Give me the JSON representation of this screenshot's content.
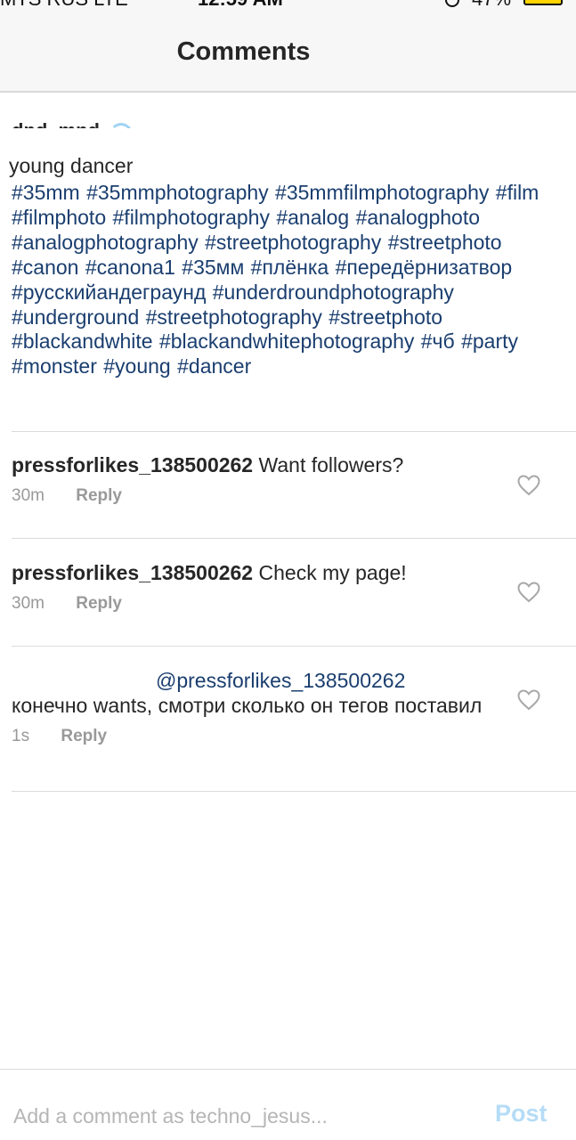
{
  "status_bar": {
    "carrier": "MTS RUS LTE",
    "time": "12:59 AM",
    "battery_pct": "47%"
  },
  "header": {
    "title": "Comments"
  },
  "caption": {
    "author": "dnd_mnd",
    "text": "young dancer",
    "hashtags": "#35mm #35mmphotography #35mmfilmphotography #film #filmphoto #filmphotography #analog #analogphoto #analogphotography #streetphotography #streetphoto #canon #canona1 #35мм #плёнка #передёрнизатвор #русскийандеграунд #underdroundphotography #underground #streetphotography #streetphoto #blackandwhite #blackandwhitephotography #чб #party #monster #young #dancer"
  },
  "comments": [
    {
      "username": "pressforlikes_138500262",
      "text": "Want followers?",
      "time": "30m",
      "reply_label": "Reply"
    },
    {
      "username": "pressforlikes_138500262",
      "text": "Check my page!",
      "time": "30m",
      "reply_label": "Reply"
    },
    {
      "username": "",
      "mention": "@pressforlikes_138500262",
      "text": "конечно wants, смотри сколько он тегов поставил",
      "time": "1s",
      "reply_label": "Reply"
    }
  ],
  "composer": {
    "placeholder": "Add a comment as techno_jesus...",
    "post_label": "Post"
  },
  "colors": {
    "hashtag": "#1a3e6f",
    "post_disabled": "#b5dcf7",
    "meta": "#999999"
  }
}
